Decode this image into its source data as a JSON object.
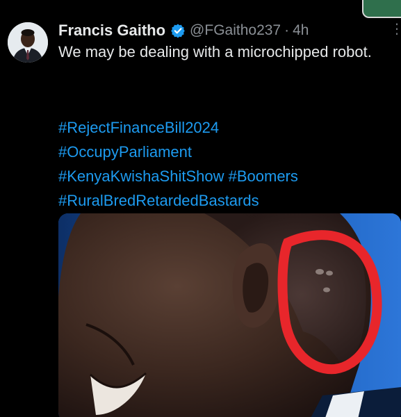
{
  "tweet": {
    "author_name": "Francis Gaitho",
    "verified_icon": "verified-badge-icon",
    "handle": "@FGaitho237",
    "separator": "·",
    "time": "4h",
    "text": "We may be dealing with a microchipped robot.",
    "hashtags": [
      "#RejectFinanceBill2024",
      "#OccupyParliament",
      "#KenyaKwishaShitShow",
      "#Boomers",
      "#RuralBredRetardedBastards"
    ],
    "more_icon": "more-dots-icon",
    "media_description_icon": "photo"
  },
  "colors": {
    "background": "#000000",
    "text": "#e7e9ea",
    "secondary_text": "#8b9096",
    "link": "#1d9bf0",
    "verified": "#1d9bf0",
    "annotation_circle": "#e8262b"
  }
}
